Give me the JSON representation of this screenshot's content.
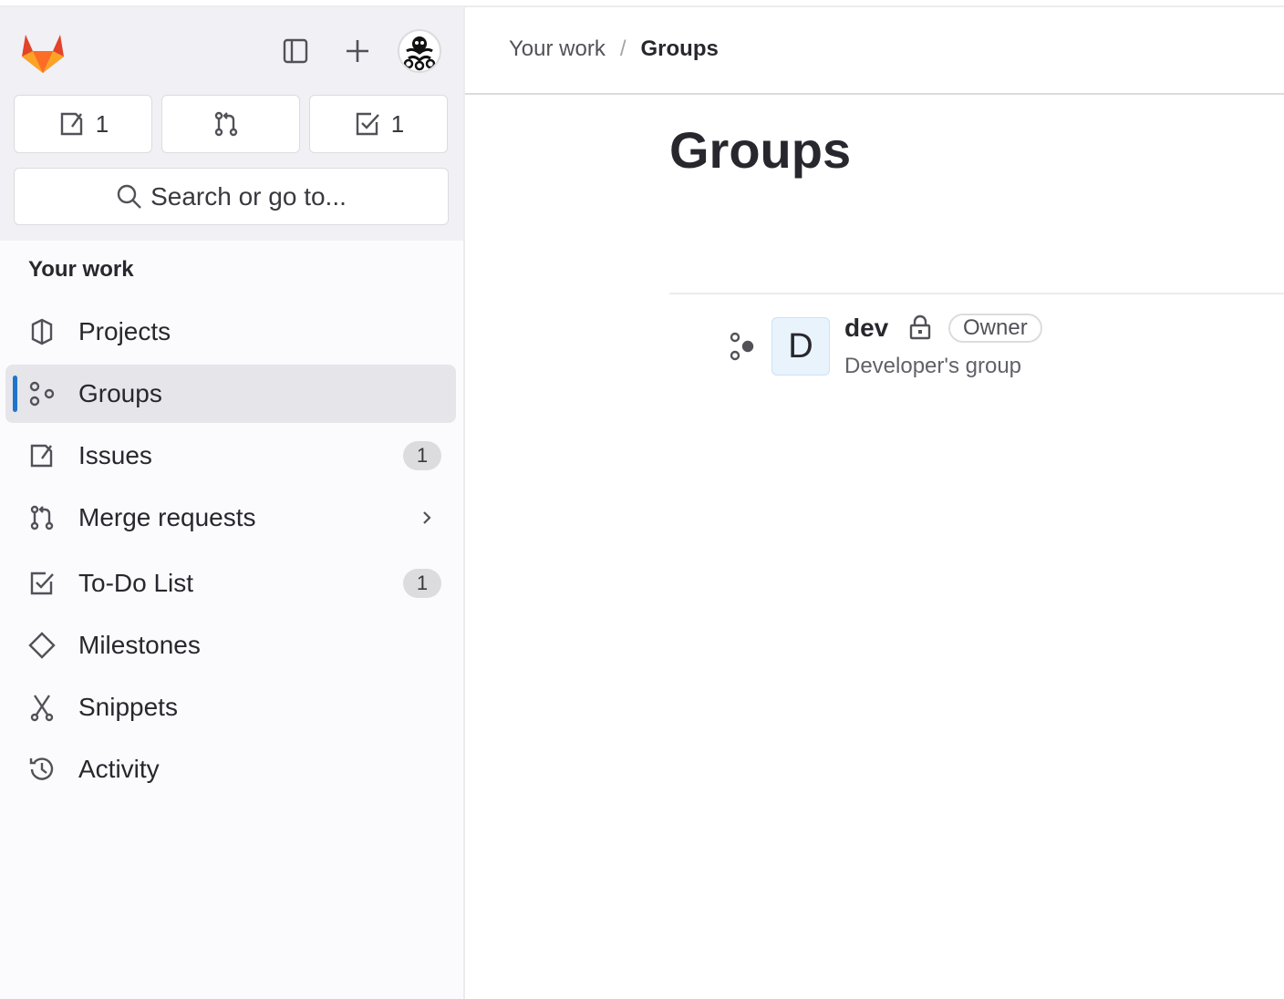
{
  "sidebar": {
    "counters": [
      {
        "icon": "issues-icon",
        "count": "1"
      },
      {
        "icon": "merge-request-icon",
        "count": ""
      },
      {
        "icon": "todo-icon",
        "count": "1"
      }
    ],
    "search_placeholder": "Search or go to...",
    "section_title": "Your work",
    "items": [
      {
        "label": "Projects",
        "icon": "project-icon",
        "badge": null,
        "active": false
      },
      {
        "label": "Groups",
        "icon": "group-icon",
        "badge": null,
        "active": true
      },
      {
        "label": "Issues",
        "icon": "issues-icon",
        "badge": "1",
        "active": false
      },
      {
        "label": "Merge requests",
        "icon": "merge-request-icon",
        "badge": null,
        "active": false,
        "expandable": true
      },
      {
        "label": "To-Do List",
        "icon": "todo-icon",
        "badge": "1",
        "active": false
      },
      {
        "label": "Milestones",
        "icon": "milestone-icon",
        "badge": null,
        "active": false
      },
      {
        "label": "Snippets",
        "icon": "snippet-icon",
        "badge": null,
        "active": false
      },
      {
        "label": "Activity",
        "icon": "history-icon",
        "badge": null,
        "active": false
      }
    ]
  },
  "breadcrumb": {
    "parent": "Your work",
    "separator": "/",
    "current": "Groups"
  },
  "page": {
    "title": "Groups"
  },
  "groups": [
    {
      "avatar_letter": "D",
      "name": "dev",
      "visibility": "private",
      "role": "Owner",
      "description": "Developer's group"
    }
  ],
  "colors": {
    "accent": "#1f75cb",
    "sidebar_bg": "#fbfafd",
    "sidebar_top_bg": "#f1f0f4",
    "active_bg": "#e6e6ea"
  }
}
